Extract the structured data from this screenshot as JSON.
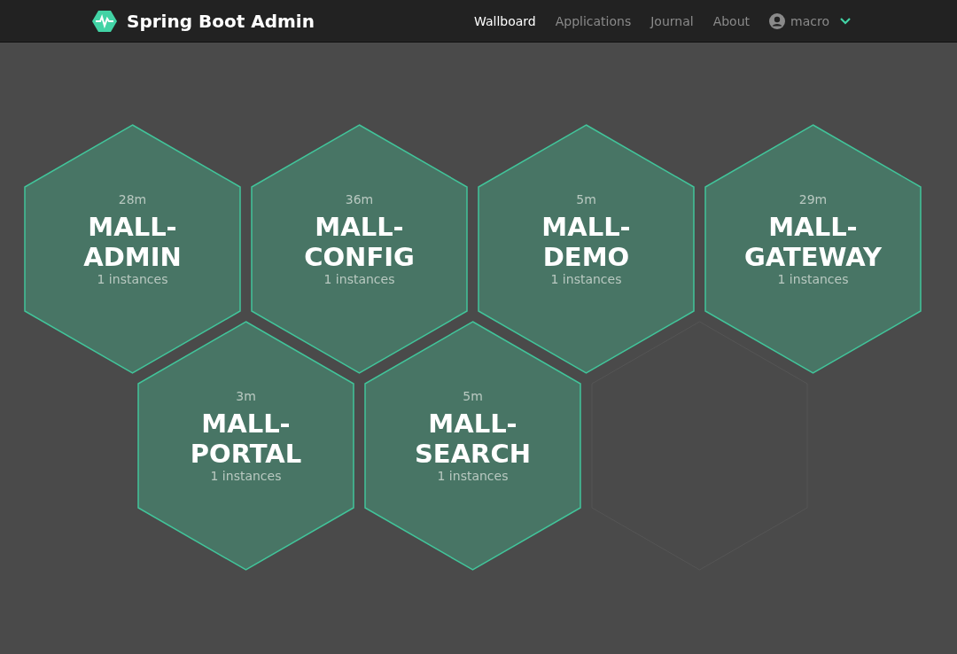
{
  "header": {
    "title": "Spring Boot Admin",
    "nav": [
      {
        "label": "Wallboard",
        "selected": true
      },
      {
        "label": "Applications",
        "selected": false
      },
      {
        "label": "Journal",
        "selected": false
      },
      {
        "label": "About",
        "selected": false
      }
    ],
    "user": "macro"
  },
  "rows": [
    {
      "tiles": [
        {
          "kind": "app",
          "uptime": "28m",
          "name": "MALL-\nADMIN",
          "instances": "1 instances"
        },
        {
          "kind": "app",
          "uptime": "36m",
          "name": "MALL-\nCONFIG",
          "instances": "1 instances"
        },
        {
          "kind": "app",
          "uptime": "5m",
          "name": "MALL-\nDEMO",
          "instances": "1 instances"
        },
        {
          "kind": "app",
          "uptime": "29m",
          "name": "MALL-\nGATEWAY",
          "instances": "1 instances"
        }
      ]
    },
    {
      "tiles": [
        {
          "kind": "app",
          "uptime": "3m",
          "name": "MALL-\nPORTAL",
          "instances": "1 instances"
        },
        {
          "kind": "app",
          "uptime": "5m",
          "name": "MALL-\nSEARCH",
          "instances": "1 instances"
        },
        {
          "kind": "empty"
        }
      ]
    }
  ]
}
